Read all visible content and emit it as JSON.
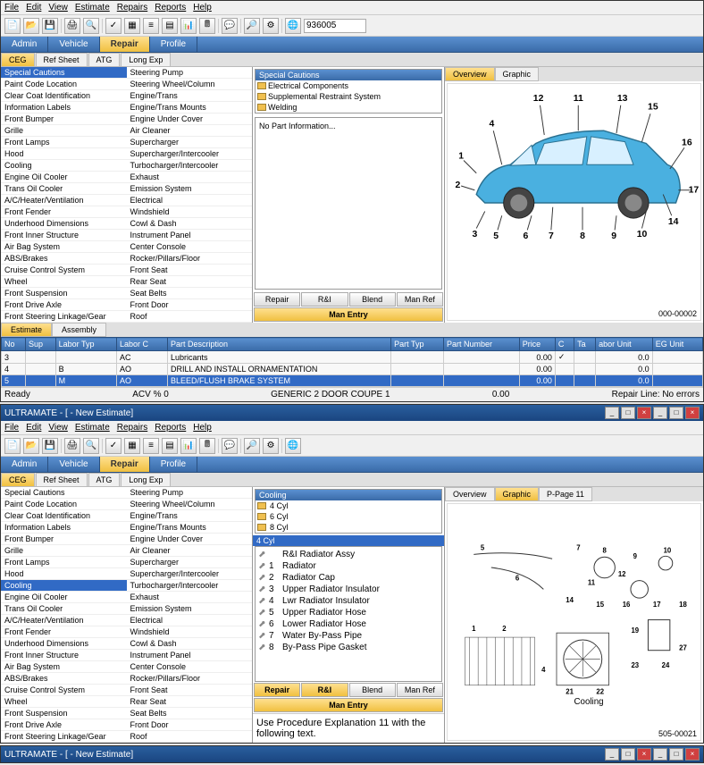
{
  "window1": {
    "menus": [
      "File",
      "Edit",
      "View",
      "Estimate",
      "Repairs",
      "Reports",
      "Help"
    ],
    "search_value": "936005",
    "navtabs": [
      {
        "label": "Admin",
        "active": false
      },
      {
        "label": "Vehicle",
        "active": false
      },
      {
        "label": "Repair",
        "active": true
      },
      {
        "label": "Profile",
        "active": false
      }
    ],
    "subtabs": [
      {
        "label": "CEG",
        "active": true
      },
      {
        "label": "Ref Sheet",
        "active": false
      },
      {
        "label": "ATG",
        "active": false
      },
      {
        "label": "Long Exp",
        "active": false
      }
    ],
    "leftcol1_hdr": "Special Cautions",
    "leftcol1": [
      "Special Cautions",
      "Paint Code Location",
      "Clear Coat Identification",
      "Information Labels",
      "Front Bumper",
      "Grille",
      "Front Lamps",
      "Hood",
      "Cooling",
      "Engine Oil Cooler",
      "Trans Oil Cooler",
      "A/C/Heater/Ventilation",
      "Front Fender",
      "Underhood Dimensions",
      "Front Inner Structure",
      "Air Bag System",
      "ABS/Brakes",
      "Cruise Control System",
      "Wheel",
      "Front Suspension",
      "Front Drive Axle",
      "Front Steering Linkage/Gear"
    ],
    "leftcol2": [
      "Steering Pump",
      "Steering Wheel/Column",
      "Engine/Trans",
      "Engine/Trans Mounts",
      "Engine Under Cover",
      "Air Cleaner",
      "Supercharger",
      "Supercharger/Intercooler",
      "Turbocharger/Intercooler",
      "Exhaust",
      "Emission System",
      "Electrical",
      "Windshield",
      "Cowl & Dash",
      "Instrument Panel",
      "Center Console",
      "Rocker/Pillars/Floor",
      "Front Seat",
      "Rear Seat",
      "Seat Belts",
      "Front Door",
      "Roof"
    ],
    "cautions_hdr": "Special Cautions",
    "cautions": [
      "Electrical Components",
      "Supplemental Restraint System",
      "Welding"
    ],
    "info_text": "No Part Information...",
    "midbtns": [
      "Repair",
      "R&I",
      "Blend",
      "Man Ref"
    ],
    "manentry": "Man Entry",
    "righttabs": [
      {
        "label": "Overview",
        "active": true
      },
      {
        "label": "Graphic",
        "active": false
      }
    ],
    "part_labels": [
      "1",
      "2",
      "3",
      "4",
      "5",
      "6",
      "7",
      "8",
      "9",
      "10",
      "11",
      "12",
      "13",
      "14",
      "15",
      "16",
      "17"
    ],
    "partcode": "000-00002",
    "esttabs": [
      {
        "label": "Estimate",
        "active": true
      },
      {
        "label": "Assembly",
        "active": false
      }
    ],
    "estcols": [
      "No",
      "Sup",
      "Labor Typ",
      "Labor C",
      "Part Description",
      "Part Typ",
      "Part Number",
      "Price",
      "C",
      "Ta",
      "abor Unit",
      "EG Unit"
    ],
    "estrows": [
      {
        "no": "3",
        "sup": "",
        "lt": "",
        "lc": "AC",
        "desc": "Lubricants",
        "pt": "",
        "pn": "",
        "price": "0.00",
        "c": "✓",
        "ta": "",
        "lu": "0.0",
        "eg": ""
      },
      {
        "no": "4",
        "sup": "",
        "lt": "B",
        "lc": "AO",
        "desc": "DRILL AND INSTALL ORNAMENTATION",
        "pt": "",
        "pn": "",
        "price": "0.00",
        "c": "",
        "ta": "",
        "lu": "0.0",
        "eg": ""
      },
      {
        "no": "5",
        "sup": "",
        "lt": "M",
        "lc": "AO",
        "desc": "BLEED/FLUSH BRAKE SYSTEM",
        "pt": "",
        "pn": "",
        "price": "0.00",
        "c": "",
        "ta": "",
        "lu": "0.0",
        "eg": "",
        "selected": true
      }
    ],
    "status_left": "Ready",
    "status_mid1": "ACV % 0",
    "status_mid2": "GENERIC 2 DOOR COUPE 1",
    "status_mid3": "0.00",
    "status_right": "Repair Line: No errors"
  },
  "window2": {
    "title": "ULTRAMATE - [ - New Estimate]",
    "menus": [
      "File",
      "Edit",
      "View",
      "Estimate",
      "Repairs",
      "Reports",
      "Help"
    ],
    "navtabs": [
      {
        "label": "Admin",
        "active": false
      },
      {
        "label": "Vehicle",
        "active": false
      },
      {
        "label": "Repair",
        "active": true
      },
      {
        "label": "Profile",
        "active": false
      }
    ],
    "subtabs": [
      {
        "label": "CEG",
        "active": true
      },
      {
        "label": "Ref Sheet",
        "active": false
      },
      {
        "label": "ATG",
        "active": false
      },
      {
        "label": "Long Exp",
        "active": false
      }
    ],
    "leftcol1": [
      "Special Cautions",
      "Paint Code Location",
      "Clear Coat Identification",
      "Information Labels",
      "Front Bumper",
      "Grille",
      "Front Lamps",
      "Hood",
      "Cooling",
      "Engine Oil Cooler",
      "Trans Oil Cooler",
      "A/C/Heater/Ventilation",
      "Front Fender",
      "Underhood Dimensions",
      "Front Inner Structure",
      "Air Bag System",
      "ABS/Brakes",
      "Cruise Control System",
      "Wheel",
      "Front Suspension",
      "Front Drive Axle",
      "Front Steering Linkage/Gear"
    ],
    "selected_idx": 8,
    "leftcol2": [
      "Steering Pump",
      "Steering Wheel/Column",
      "Engine/Trans",
      "Engine/Trans Mounts",
      "Engine Under Cover",
      "Air Cleaner",
      "Supercharger",
      "Supercharger/Intercooler",
      "Turbocharger/Intercooler",
      "Exhaust",
      "Emission System",
      "Electrical",
      "Windshield",
      "Cowl & Dash",
      "Instrument Panel",
      "Center Console",
      "Rocker/Pillars/Floor",
      "Front Seat",
      "Rear Seat",
      "Seat Belts",
      "Front Door",
      "Roof"
    ],
    "cooling_hdr": "Cooling",
    "cyls": [
      "4 Cyl",
      "6 Cyl",
      "8 Cyl"
    ],
    "cyl_selected": "4 Cyl",
    "parts": [
      {
        "n": "",
        "name": "R&I Radiator Assy"
      },
      {
        "n": "1",
        "name": "Radiator"
      },
      {
        "n": "2",
        "name": "Radiator Cap"
      },
      {
        "n": "3",
        "name": "Upper Radiator Insulator"
      },
      {
        "n": "4",
        "name": "Lwr Radiator Insulator"
      },
      {
        "n": "5",
        "name": "Upper Radiator Hose"
      },
      {
        "n": "6",
        "name": "Lower Radiator Hose"
      },
      {
        "n": "7",
        "name": "Water By-Pass Pipe"
      },
      {
        "n": "8",
        "name": "By-Pass Pipe Gasket"
      }
    ],
    "midbtns": [
      "Repair",
      "R&I",
      "Blend",
      "Man Ref"
    ],
    "manentry": "Man Entry",
    "procedure": "Use Procedure Explanation 11 with the following text.",
    "righttabs": [
      {
        "label": "Overview",
        "active": false
      },
      {
        "label": "Graphic",
        "active": true
      },
      {
        "label": "P-Page 11",
        "active": false
      }
    ],
    "diagram_labels": [
      "1",
      "2",
      "4",
      "5",
      "6",
      "7",
      "8",
      "9",
      "10",
      "11",
      "12",
      "14",
      "15",
      "16",
      "17",
      "18",
      "19",
      "21",
      "22",
      "23",
      "24",
      "27"
    ],
    "diagram_title": "Cooling",
    "partcode": "505-00021"
  },
  "window3": {
    "title": "ULTRAMATE - [ - New Estimate]"
  }
}
